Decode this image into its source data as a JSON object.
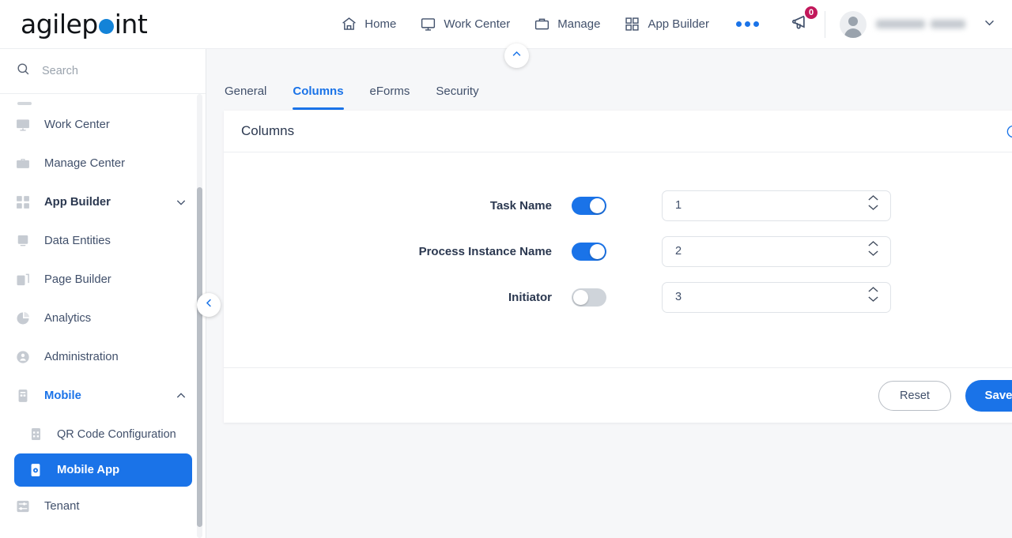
{
  "header": {
    "logo_text_before": "agilep",
    "logo_text_after": "int",
    "nav": [
      {
        "label": "Home",
        "icon": "home-icon"
      },
      {
        "label": "Work Center",
        "icon": "monitor-icon"
      },
      {
        "label": "Manage",
        "icon": "briefcase-icon"
      },
      {
        "label": "App Builder",
        "icon": "grid-icon"
      }
    ],
    "more_icon": "more-dots-icon",
    "announcement_icon": "megaphone-icon",
    "announcement_count": "0",
    "avatar_icon": "user-avatar-icon",
    "account_chevron_icon": "chevron-down-icon"
  },
  "sidebar": {
    "search_placeholder": "Search",
    "search_value": "",
    "search_icon": "search-icon",
    "items": [
      {
        "label": "Work Center",
        "icon": "work-center-icon",
        "state": "normal",
        "indent": false
      },
      {
        "label": "Manage Center",
        "icon": "manage-center-icon",
        "state": "normal",
        "indent": false
      },
      {
        "label": "App Builder",
        "icon": "app-builder-icon",
        "state": "bold",
        "indent": false,
        "chevron": "chevron-down-icon"
      },
      {
        "label": "Data Entities",
        "icon": "data-entities-icon",
        "state": "normal",
        "indent": false
      },
      {
        "label": "Page Builder",
        "icon": "page-builder-icon",
        "state": "normal",
        "indent": false
      },
      {
        "label": "Analytics",
        "icon": "analytics-icon",
        "state": "normal",
        "indent": false
      },
      {
        "label": "Administration",
        "icon": "administration-icon",
        "state": "normal",
        "indent": false
      },
      {
        "label": "Mobile",
        "icon": "mobile-icon",
        "state": "expanded",
        "indent": false,
        "chevron": "chevron-up-icon"
      },
      {
        "label": "QR Code Configuration",
        "icon": "qr-code-icon",
        "state": "normal",
        "indent": true
      },
      {
        "label": "Mobile App",
        "icon": "mobile-app-icon",
        "state": "active",
        "indent": false
      },
      {
        "label": "Tenant",
        "icon": "tenant-icon",
        "state": "normal",
        "indent": false
      }
    ],
    "collapse_icon": "chevron-left-icon"
  },
  "main": {
    "panel_collapse_icon": "chevron-up-icon",
    "tabs": [
      {
        "label": "General",
        "active": false
      },
      {
        "label": "Columns",
        "active": true
      },
      {
        "label": "eForms",
        "active": false
      },
      {
        "label": "Security",
        "active": false
      }
    ],
    "card": {
      "title": "Columns",
      "info_icon": "info-icon",
      "rows": [
        {
          "label": "Task Name",
          "enabled": true,
          "order": "1"
        },
        {
          "label": "Process Instance Name",
          "enabled": true,
          "order": "2"
        },
        {
          "label": "Initiator",
          "enabled": false,
          "order": "3"
        }
      ],
      "reset_label": "Reset",
      "save_label": "Save"
    }
  },
  "colors": {
    "accent_blue": "#1a73e8",
    "logo_blue": "#1383d8",
    "badge_magenta": "#c2185b",
    "text_dark": "#2b3850",
    "text_muted": "#41506b",
    "toggle_off": "#cfd4da",
    "page_bg": "#f6f7f9"
  }
}
